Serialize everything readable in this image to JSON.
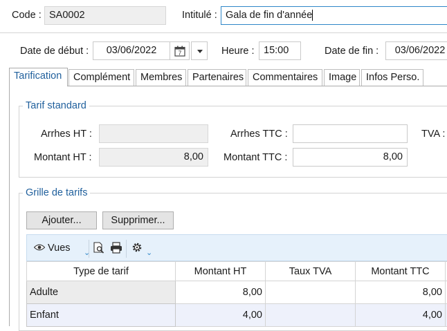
{
  "header": {
    "code_label": "Code :",
    "code_value": "SA0002",
    "intitule_label": "Intitulé :",
    "intitule_value": "Gala de fin d'année"
  },
  "dates": {
    "debut_label": "Date de début :",
    "debut_value": "03/06/2022",
    "heure_label": "Heure :",
    "heure_value": "15:00",
    "fin_label": "Date de fin :",
    "fin_value": "03/06/2022"
  },
  "tabs": [
    {
      "label": "Tarification",
      "active": true
    },
    {
      "label": "Complément"
    },
    {
      "label": "Membres"
    },
    {
      "label": "Partenaires"
    },
    {
      "label": "Commentaires"
    },
    {
      "label": "Image"
    },
    {
      "label": "Infos Perso."
    }
  ],
  "tarif_standard": {
    "title": "Tarif standard",
    "arrhes_ht_label": "Arrhes HT :",
    "arrhes_ht_value": "",
    "arrhes_ttc_label": "Arrhes TTC :",
    "arrhes_ttc_value": "",
    "tva_label": "TVA :",
    "montant_ht_label": "Montant HT :",
    "montant_ht_value": "8,00",
    "montant_ttc_label": "Montant TTC :",
    "montant_ttc_value": "8,00"
  },
  "grille": {
    "title": "Grille de tarifs",
    "ajouter_label": "Ajouter...",
    "supprimer_label": "Supprimer...",
    "vues_label": "Vues",
    "columns": [
      "Type de tarif",
      "Montant HT",
      "Taux TVA",
      "Montant TTC"
    ],
    "rows": [
      {
        "type": "Adulte",
        "montant_ht": "8,00",
        "taux_tva": "",
        "montant_ttc": "8,00"
      },
      {
        "type": "Enfant",
        "montant_ht": "4,00",
        "taux_tva": "",
        "montant_ttc": "4,00"
      }
    ]
  },
  "colors": {
    "accent": "#1f5f9c",
    "focus": "#2f86c8",
    "toolbar_bg": "#e6f1fb"
  }
}
